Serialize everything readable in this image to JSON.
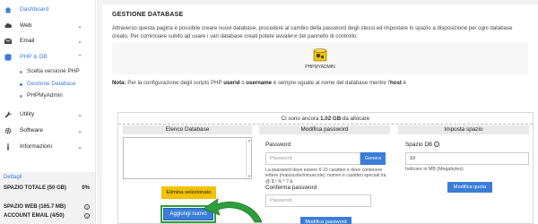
{
  "sidebar": {
    "items": [
      {
        "label": "Dashboard",
        "icon": "home-icon",
        "active": true
      },
      {
        "label": "Web",
        "icon": "cloud-icon"
      },
      {
        "label": "Email",
        "icon": "envelope-icon"
      },
      {
        "label": "PHP & DB",
        "icon": "database-icon",
        "active": true
      },
      {
        "label": "Utility",
        "icon": "wrench-icon"
      },
      {
        "label": "Software",
        "icon": "gear-icon"
      },
      {
        "label": "Informazioni",
        "icon": "info-icon"
      }
    ],
    "subitems": [
      {
        "label": "Scelta versione PHP"
      },
      {
        "label": "Gestione Database",
        "active": true
      },
      {
        "label": "PHPMyAdmin"
      }
    ],
    "stats": {
      "heading": "Dettagli",
      "total_label": "SPAZIO TOTALE (50 GB)",
      "total_value": "0%",
      "web_label": "SPAZIO WEB (165.7 MB)",
      "email_label": "ACCOUNT EMAIL (4/50)"
    }
  },
  "main": {
    "title": "GESTIONE DATABASE",
    "description": "Attraverso questa pagina è possibile creare nuovi database, procedere al cambio della password degli stessi ed impostare lo spazio a disposizione per ogni database creato. Per cominciare subito ad usare i vari database creati potete avvalervi del pannello di controllo:",
    "phpmyadmin_label": "PHPMYADMIN",
    "note_prefix": "Nota:",
    "note_text1": " Per la configurazione degli scripts PHP ",
    "note_bold1": "userid",
    "note_text2": " o ",
    "note_bold2": "username",
    "note_text3": " è sempre uguale al nome del database mentre l'",
    "note_bold3": "host",
    "note_text4": " è",
    "panel": {
      "header_prefix": "Ci sono ancora ",
      "header_value": "1.02 GB",
      "header_suffix": " da allocare",
      "col1_title": "Elenco Database",
      "col2_title": "Modifica password",
      "col3_title": "Imposta spazio",
      "delete_button": "Elimina selezionato",
      "add_button": "Aggiungi nuovo",
      "password_label": "Password",
      "password_placeholder": "Password",
      "generate_button": "Genera",
      "password_hint": "La password deve essere 6-15 caratteri e deve contenere lettere (maiuscole/minuscole), numeri e caratteri speciali tra @ $ ! % * ? &",
      "confirm_label": "Conferma password",
      "confirm_placeholder": "Password",
      "password_button": "Modifica password",
      "space_label": "Spazio DB",
      "space_value": "10",
      "space_hint": "Indicare in MB (Megabytes)",
      "quota_button": "Modifica quota"
    }
  },
  "colors": {
    "accent": "#3b7dd8",
    "warning_button": "#f2c200",
    "highlight_arrow": "#2e9e3a"
  }
}
